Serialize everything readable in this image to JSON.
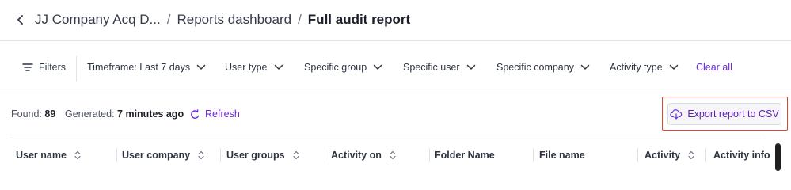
{
  "breadcrumb": {
    "items": [
      "JJ Company Acq D...",
      "Reports dashboard"
    ],
    "separator": "/",
    "current": "Full audit report"
  },
  "filters": {
    "filters_label": "Filters",
    "timeframe": "Timeframe: Last 7 days",
    "user_type": "User type",
    "specific_group": "Specific group",
    "specific_user": "Specific user",
    "specific_company": "Specific company",
    "activity_type": "Activity type",
    "clear_all": "Clear all"
  },
  "stats": {
    "found_label": "Found:",
    "found_value": "89",
    "generated_label": "Generated:",
    "generated_value": "7 minutes ago",
    "refresh": "Refresh"
  },
  "export": {
    "label": "Export report to CSV"
  },
  "table": {
    "columns": [
      "User name",
      "User company",
      "User groups",
      "Activity on",
      "Folder Name",
      "File name",
      "Activity",
      "Activity info"
    ]
  },
  "colors": {
    "accent": "#6b2bd9",
    "highlight": "#e0442a"
  },
  "icons": [
    "chevron-left-icon",
    "filter-lines-icon",
    "chevron-down-icon",
    "refresh-icon",
    "cloud-download-icon",
    "sort-icon"
  ]
}
